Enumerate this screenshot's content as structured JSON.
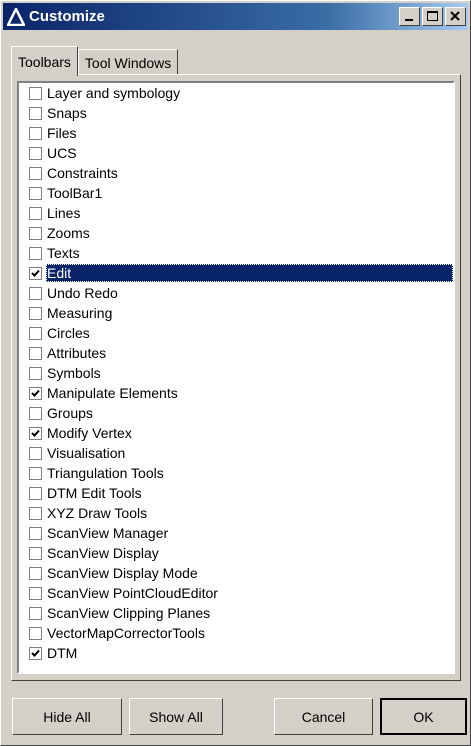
{
  "window": {
    "title": "Customize"
  },
  "tabs": [
    {
      "label": "Toolbars"
    },
    {
      "label": "Tool Windows"
    }
  ],
  "toolbars": [
    {
      "label": "Layer and symbology",
      "checked": false
    },
    {
      "label": "Snaps",
      "checked": false
    },
    {
      "label": "Files",
      "checked": false
    },
    {
      "label": "UCS",
      "checked": false
    },
    {
      "label": "Constraints",
      "checked": false
    },
    {
      "label": "ToolBar1",
      "checked": false
    },
    {
      "label": "Lines",
      "checked": false
    },
    {
      "label": "Zooms",
      "checked": false
    },
    {
      "label": "Texts",
      "checked": false
    },
    {
      "label": "Edit",
      "checked": true,
      "selected": true
    },
    {
      "label": "Undo Redo",
      "checked": false
    },
    {
      "label": "Measuring",
      "checked": false
    },
    {
      "label": "Circles",
      "checked": false
    },
    {
      "label": "Attributes",
      "checked": false
    },
    {
      "label": "Symbols",
      "checked": false
    },
    {
      "label": "Manipulate Elements",
      "checked": true
    },
    {
      "label": "Groups",
      "checked": false
    },
    {
      "label": "Modify Vertex",
      "checked": true
    },
    {
      "label": "Visualisation",
      "checked": false
    },
    {
      "label": "Triangulation Tools",
      "checked": false
    },
    {
      "label": "DTM Edit Tools",
      "checked": false
    },
    {
      "label": "XYZ Draw Tools",
      "checked": false
    },
    {
      "label": "ScanView Manager",
      "checked": false
    },
    {
      "label": "ScanView Display",
      "checked": false
    },
    {
      "label": "ScanView Display Mode",
      "checked": false
    },
    {
      "label": "ScanView PointCloudEditor",
      "checked": false
    },
    {
      "label": "ScanView Clipping Planes",
      "checked": false
    },
    {
      "label": "VectorMapCorrectorTools",
      "checked": false
    },
    {
      "label": "DTM",
      "checked": true
    }
  ],
  "buttons": {
    "hide_all": "Hide All",
    "show_all": "Show All",
    "cancel": "Cancel",
    "ok": "OK"
  },
  "colors": {
    "titlebar": "#0a246a",
    "selection": "#0a246a",
    "face": "#d4d0c8"
  }
}
